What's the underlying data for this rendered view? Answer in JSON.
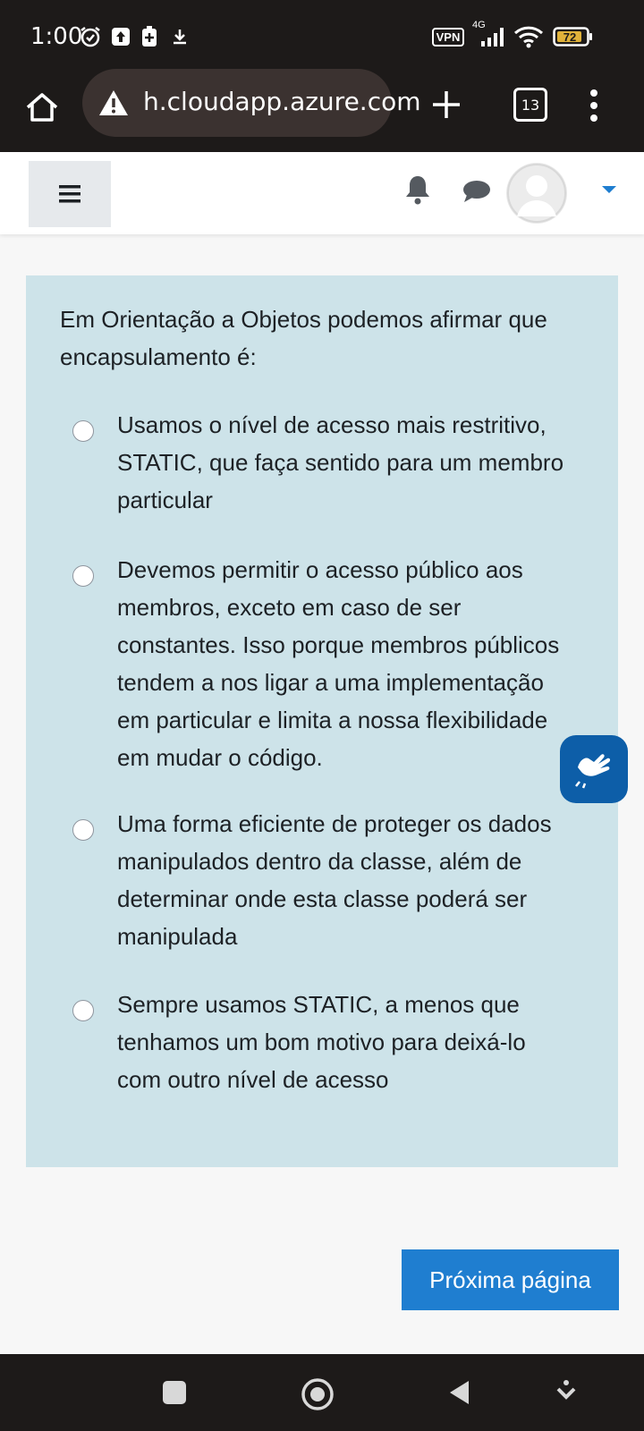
{
  "status_bar": {
    "time": "1:00",
    "network": "4G",
    "vpn": "VPN",
    "battery": "72"
  },
  "browser": {
    "url": "h.cloudapp.azure.com",
    "tab_count": "13"
  },
  "question": {
    "prompt": "Em Orientação a Objetos podemos afirmar que encapsulamento é:",
    "options": [
      " Usamos o nível de acesso mais restritivo, STATIC, que faça sentido para um membro particular",
      "Devemos permitir o acesso público aos membros, exceto em caso de ser constantes. Isso porque membros públicos tendem a nos ligar a uma implementação em particular e limita a nossa flexibilidade em mudar o código.",
      "Uma forma eficiente de proteger os dados manipulados dentro da classe, além de determinar onde esta classe poderá ser manipulada",
      " Sempre usamos STATIC, a menos que tenhamos um bom motivo para deixá-lo com outro nível de acesso"
    ]
  },
  "navigation": {
    "next_label": "Próxima página"
  },
  "colors": {
    "card_bg": "#cde3e9",
    "accent": "#1f7ed0",
    "system_bar": "#1d1a19"
  }
}
